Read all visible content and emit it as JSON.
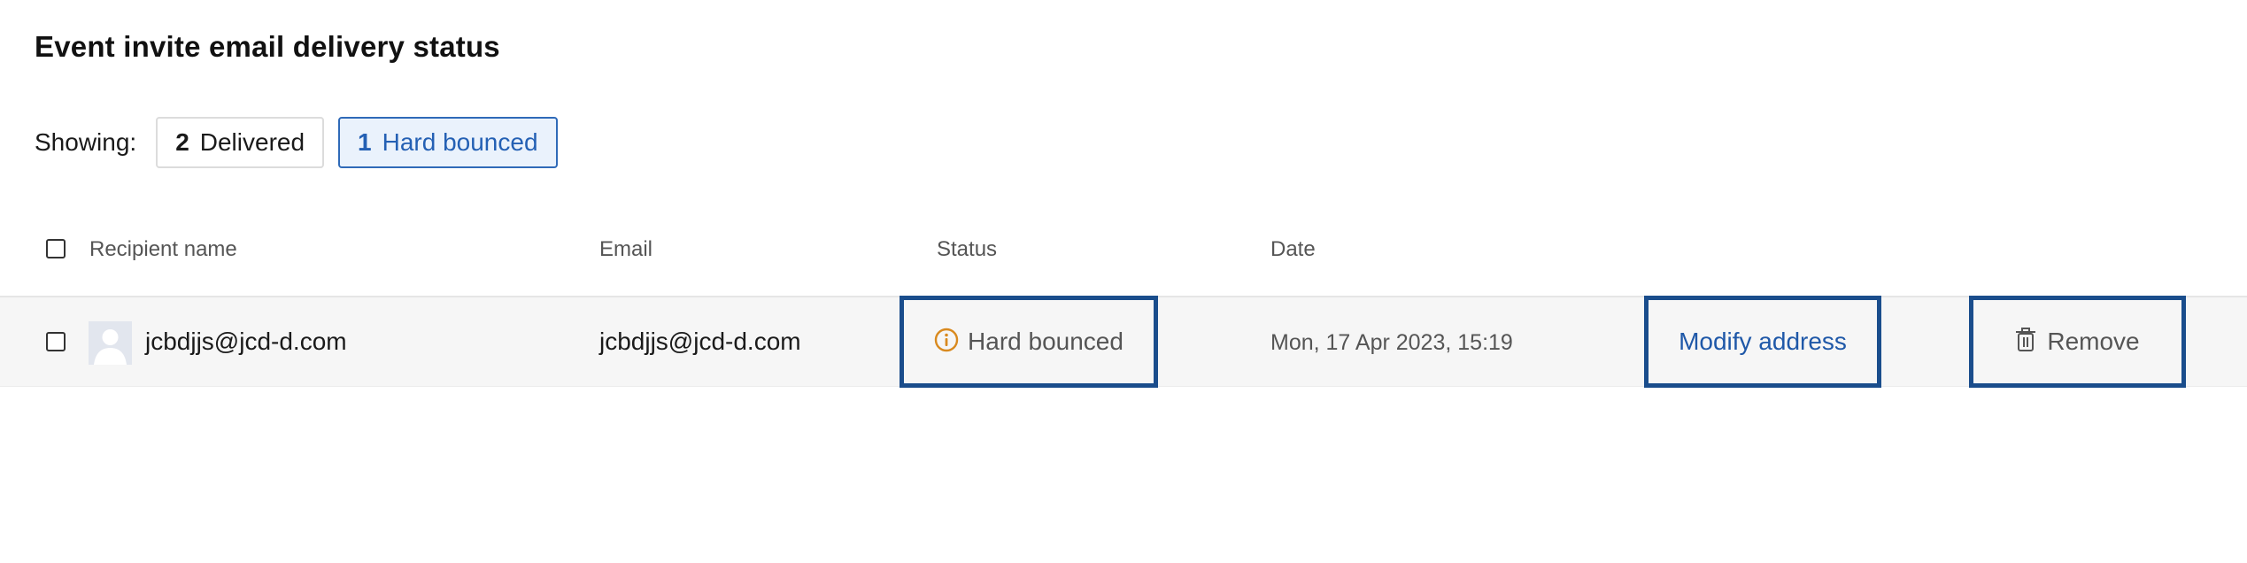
{
  "page": {
    "title": "Event invite email delivery status"
  },
  "filters": {
    "label": "Showing:",
    "chips": [
      {
        "count": "2",
        "label": "Delivered",
        "active": false
      },
      {
        "count": "1",
        "label": "Hard bounced",
        "active": true
      }
    ]
  },
  "table": {
    "columns": {
      "name": "Recipient name",
      "email": "Email",
      "status": "Status",
      "date": "Date"
    },
    "rows": [
      {
        "name": "jcbdjjs@jcd-d.com",
        "email": "jcbdjjs@jcd-d.com",
        "status": "Hard bounced",
        "status_icon": "info-icon",
        "date": "Mon, 17 Apr 2023, 15:19",
        "action_modify": "Modify address",
        "action_remove": "Remove",
        "remove_icon": "trash-icon"
      }
    ]
  },
  "colors": {
    "accent": "#2460b4",
    "chip_active_bg": "#eaf2fc",
    "highlight_border": "#1a4d8c",
    "warning_icon": "#d98a1f",
    "row_bg": "#f6f6f6"
  }
}
